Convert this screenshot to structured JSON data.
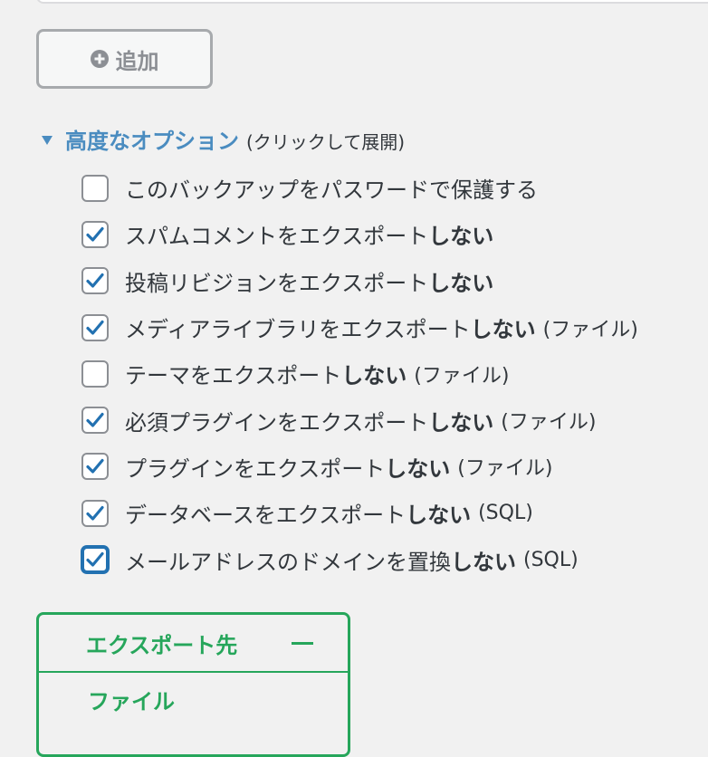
{
  "add_button": {
    "label": "追加"
  },
  "advanced": {
    "title": "高度なオプション",
    "hint": "(クリックして展開)"
  },
  "options": [
    {
      "text": "このバックアップをパスワードで保護する",
      "strong": "",
      "suffix": "",
      "checked": false
    },
    {
      "text": "スパムコメントをエクスポート",
      "strong": "しない",
      "suffix": "",
      "checked": true
    },
    {
      "text": "投稿リビジョンをエクスポート",
      "strong": "しない",
      "suffix": "",
      "checked": true
    },
    {
      "text": "メディアライブラリをエクスポート",
      "strong": "しない",
      "suffix": "(ファイル)",
      "checked": true
    },
    {
      "text": "テーマをエクスポート",
      "strong": "しない",
      "suffix": "(ファイル)",
      "checked": false
    },
    {
      "text": "必須プラグインをエクスポート",
      "strong": "しない",
      "suffix": "(ファイル)",
      "checked": true
    },
    {
      "text": "プラグインをエクスポート",
      "strong": "しない",
      "suffix": "(ファイル)",
      "checked": true
    },
    {
      "text": "データベースをエクスポート",
      "strong": "しない",
      "suffix": "(SQL)",
      "checked": true
    },
    {
      "text": "メールアドレスのドメインを置換",
      "strong": "しない",
      "suffix": "(SQL)",
      "checked": true,
      "focused": true
    }
  ],
  "export_panel": {
    "title": "エクスポート先",
    "items": [
      "ファイル"
    ]
  },
  "colors": {
    "link_blue": "#4a8cc0",
    "check_blue": "#2271b1",
    "export_green": "#26a65b",
    "text": "#32373c"
  },
  "icons": {
    "add": "plus-circle-icon",
    "toggle": "triangle-down-icon",
    "check": "checkmark-icon",
    "collapse": "minus-icon"
  }
}
